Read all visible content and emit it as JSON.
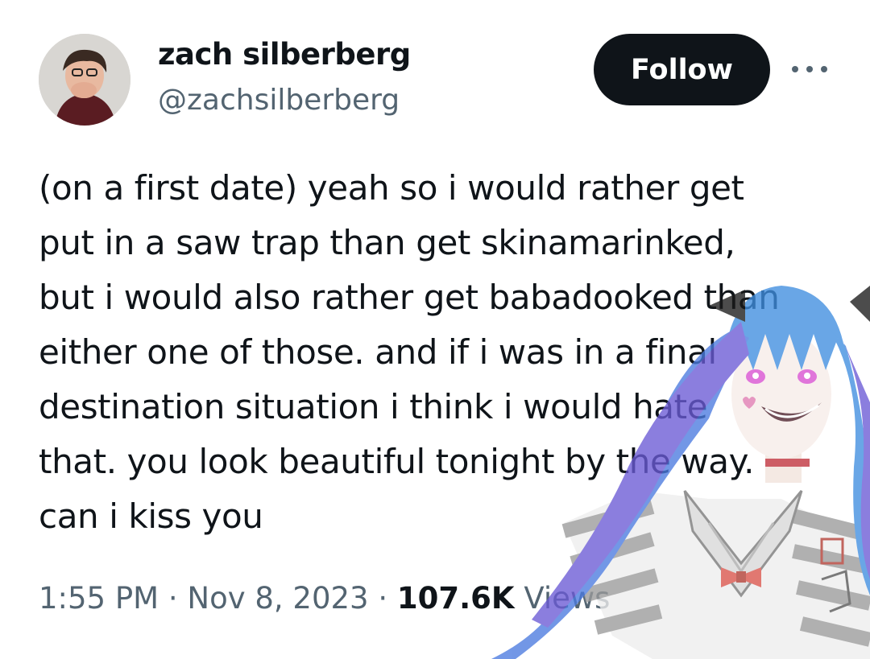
{
  "author": {
    "display_name": "zach silberberg",
    "handle": "@zachsilberberg",
    "avatar_icon": "profile-photo"
  },
  "actions": {
    "follow_label": "Follow",
    "more_icon": "more-horizontal-icon"
  },
  "tweet": {
    "lines": [
      "(on a first date) yeah so i would rather get",
      "put in a saw trap than get skinamarinked,",
      "but i would also rather get babadooked than",
      "either one of those. and if i was in a final",
      "destination situation i think i would hate",
      "that. you look beautiful tonight by the way.",
      "can i kiss you"
    ]
  },
  "meta": {
    "time": "1:55 PM",
    "separator": "·",
    "date": "Nov 8, 2023",
    "views_count": "107.6K",
    "views_label": "Views"
  },
  "colors": {
    "text": "#0f1419",
    "secondary": "#536471",
    "button_bg": "#0f1419",
    "hair_blue": "#3f8ee0",
    "hair_purple": "#6b5bd6"
  }
}
